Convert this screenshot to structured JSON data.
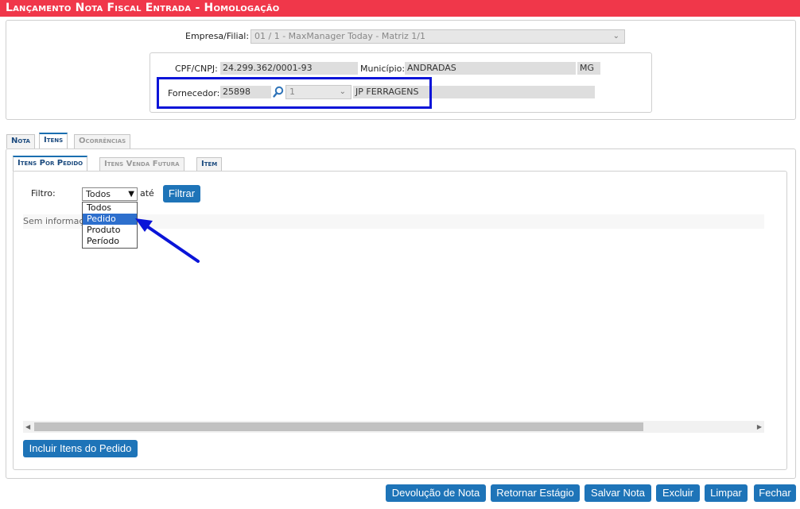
{
  "header": {
    "title": "Lançamento Nota Fiscal Entrada  - Homologação"
  },
  "empresa": {
    "label": "Empresa/Filial:",
    "value": "01 / 1 - MaxManager Today - Matriz 1/1"
  },
  "cpf": {
    "label": "CPF/CNPJ:",
    "value": "24.299.362/0001-93"
  },
  "municipio": {
    "label": "Município:",
    "value": "ANDRADAS",
    "uf": "MG"
  },
  "fornecedor": {
    "label": "Fornecedor:",
    "code": "25898",
    "seq": "1",
    "name": "JP FERRAGENS"
  },
  "tabs": [
    {
      "label": "Nota"
    },
    {
      "label": "Itens"
    },
    {
      "label": "Ocorrências"
    }
  ],
  "subtabs": [
    {
      "label": "Itens Por Pedido"
    },
    {
      "label": "Itens Venda Futura"
    },
    {
      "label": "Item"
    }
  ],
  "filtro": {
    "label": "Filtro:",
    "selected": "Todos",
    "ate": "até",
    "button": "Filtrar",
    "options": [
      "Todos",
      "Pedido",
      "Produto",
      "Período"
    ]
  },
  "empty_text": "Sem informações",
  "incluir_button": "Incluir Itens do Pedido",
  "footer": {
    "devolucao": "Devolução de Nota",
    "retornar": "Retornar Estágio",
    "salvar": "Salvar Nota",
    "excluir": "Excluir",
    "limpar": "Limpar",
    "fechar": "Fechar"
  },
  "colors": {
    "title_bar": "#f0374a",
    "button": "#1e74b8",
    "highlight": "#0a14d8",
    "dropdown_selected": "#2d6fcd"
  }
}
